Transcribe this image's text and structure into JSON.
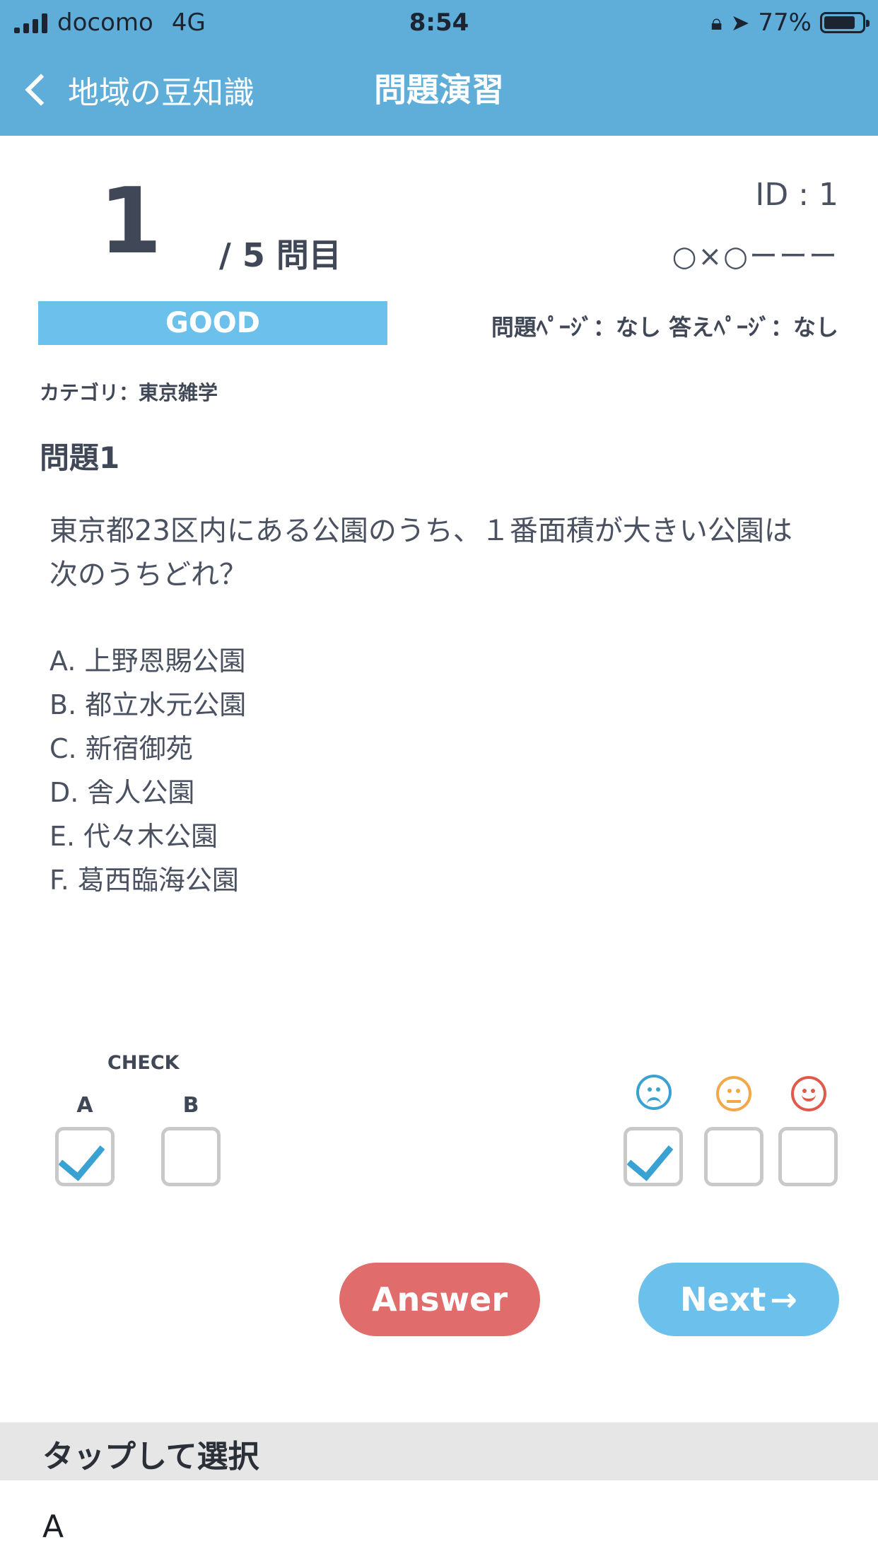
{
  "status_bar": {
    "carrier": "docomo",
    "network": "4G",
    "time": "8:54",
    "battery": "77%"
  },
  "nav": {
    "back_label": "地域の豆知識",
    "title": "問題演習"
  },
  "question": {
    "number": "1",
    "total": "/ 5 問目",
    "id": "ID : 1",
    "history": "○×○ーーー",
    "rating": "GOOD",
    "pages": "問題ﾍﾟｰｼﾞ：なし  答えﾍﾟｰｼﾞ：なし",
    "category": "カテゴリ：東京雑学",
    "title": "問題1",
    "text_line1": "東京都23区内にある公園のうち、１番面積が大きい公園は",
    "text_line2": "次のうちどれ？",
    "choices": [
      "A. 上野恩賜公園",
      "B. 都立水元公園",
      "C. 新宿御苑",
      "D. 舎人公園",
      "E. 代々木公園",
      "F. 葛西臨海公園"
    ]
  },
  "check": {
    "heading": "CHECK",
    "options": [
      {
        "label": "A",
        "checked": true
      },
      {
        "label": "B",
        "checked": false
      }
    ]
  },
  "feeling": {
    "options": [
      {
        "icon": "sad-face-icon",
        "color": "#3aa2d2",
        "checked": true
      },
      {
        "icon": "neutral-face-icon",
        "color": "#f0a848",
        "checked": false
      },
      {
        "icon": "happy-face-icon",
        "color": "#e05a4c",
        "checked": false
      }
    ]
  },
  "buttons": {
    "answer": "Answer",
    "next": "Next"
  },
  "picker": {
    "title": "タップして選択",
    "value": "A"
  }
}
